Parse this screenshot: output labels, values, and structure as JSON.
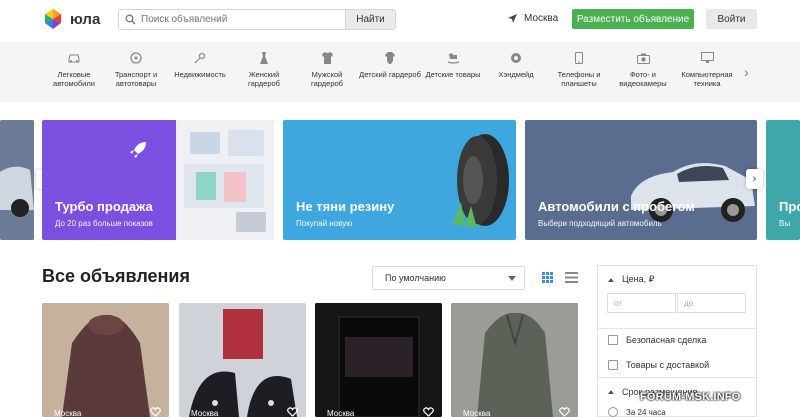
{
  "header": {
    "logo_text": "юла",
    "search_placeholder": "Поиск объявлений",
    "search_button": "Найти",
    "location": "Москва",
    "post_button": "Разместить объявление",
    "login_button": "Войти"
  },
  "categories": [
    {
      "label": "Легковые автомобили",
      "icon": "car-icon"
    },
    {
      "label": "Транспорт и автотовары",
      "icon": "wheel-icon"
    },
    {
      "label": "Недвижимость",
      "icon": "key-icon"
    },
    {
      "label": "Женский гардероб",
      "icon": "dress-icon"
    },
    {
      "label": "Мужской гардероб",
      "icon": "shirt-icon"
    },
    {
      "label": "Детский гардероб",
      "icon": "onesie-icon"
    },
    {
      "label": "Детские товары",
      "icon": "rocking-horse-icon"
    },
    {
      "label": "Хэндмейд",
      "icon": "yarn-icon"
    },
    {
      "label": "Телефоны и планшеты",
      "icon": "phone-icon"
    },
    {
      "label": "Фото- и видеокамеры",
      "icon": "camera-icon"
    },
    {
      "label": "Компьютерная техника",
      "icon": "monitor-icon"
    }
  ],
  "banners": [
    {
      "title": "Турбо продажа",
      "subtitle": "До 20 раз больше показов",
      "color": "#7b4fe0"
    },
    {
      "title": "Не тяни резину",
      "subtitle": "Покупай новую",
      "color": "#3fa7e0"
    },
    {
      "title": "Автомобили с пробегом",
      "subtitle": "Выбери подходящий автомобиль",
      "color": "#5a6d8f"
    },
    {
      "title": "Про",
      "subtitle": "Вы"
    }
  ],
  "listings": {
    "title": "Все объявления",
    "sort_value": "По умолчанию",
    "items": [
      {
        "location": "Москва"
      },
      {
        "location": "Москва"
      },
      {
        "location": "Москва"
      },
      {
        "location": "Москва"
      }
    ]
  },
  "filters": {
    "price_title": "Цена, ₽",
    "price_from": "от",
    "price_to": "до",
    "safe_deal": "Безопасная сделка",
    "delivery": "Товары с доставкой",
    "period_title": "Срок размещения",
    "period_option": "За 24 часа"
  },
  "watermark": "FORUM-MSK.INFO",
  "colors": {
    "accent_green": "#4bb04f",
    "turbo_purple": "#7b4fe0",
    "tire_blue": "#3fa7e0",
    "car_slate": "#5a6d8f"
  }
}
